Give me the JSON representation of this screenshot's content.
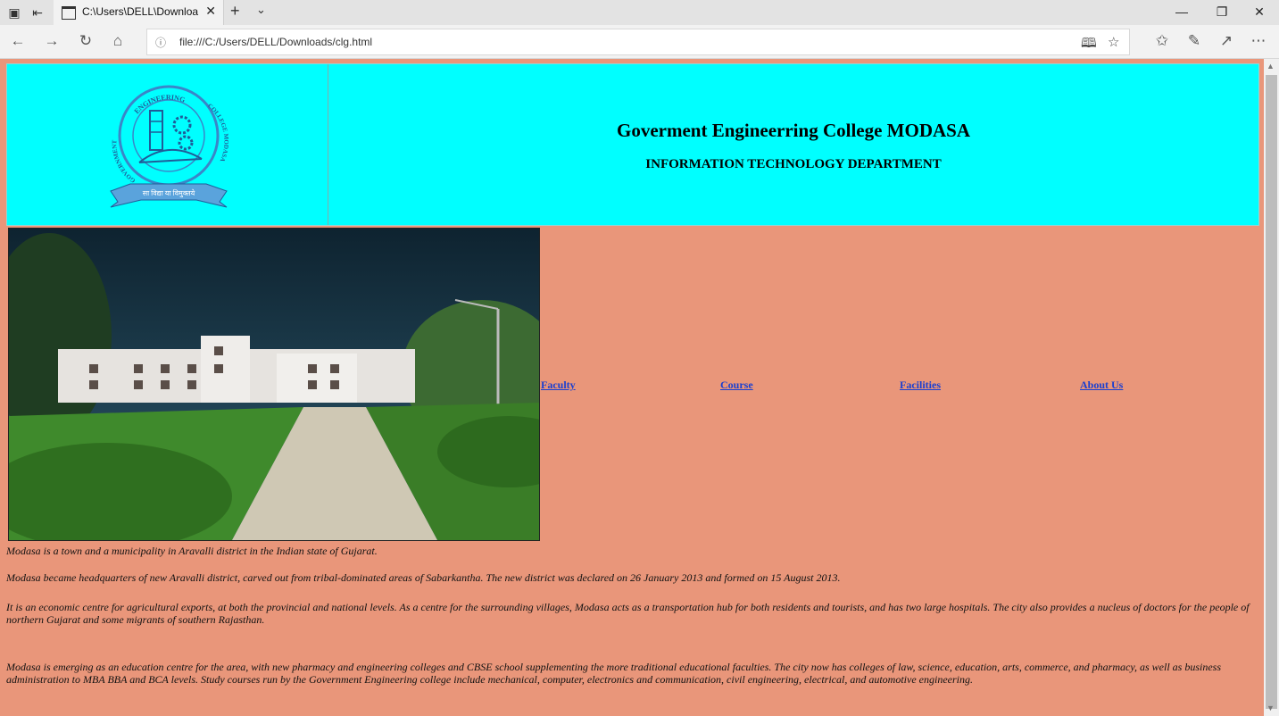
{
  "browser": {
    "tab_title": "C:\\Users\\DELL\\Downloa",
    "address_url": "file:///C:/Users/DELL/Downloads/clg.html"
  },
  "icons": {
    "tab_actions_a": "tab-preview-icon",
    "tab_actions_b": "set-aside-tabs-icon",
    "page": "page-icon",
    "close": "close-icon",
    "new_tab": "plus-icon",
    "tab_dropdown": "chevron-down-icon",
    "back": "back-arrow-icon",
    "forward": "forward-arrow-icon",
    "refresh": "refresh-icon",
    "home": "home-icon",
    "info": "info-icon",
    "reading_view": "reading-view-icon",
    "favorite": "star-icon",
    "favorites_hub": "favorites-list-icon",
    "notes": "pen-icon",
    "share": "share-icon",
    "more": "more-icon",
    "minimize": "minimize-icon",
    "restore": "restore-icon",
    "window_close": "window-close-icon"
  },
  "header": {
    "college_name": "Goverment Engineerring College MODASA",
    "department": "INFORMATION TECHNOLOGY DEPARTMENT",
    "logo_text_top": "ENGINEERING",
    "logo_text_right": "COLLEGE MODASA",
    "logo_text_left": "GOVERNMENT",
    "logo_ribbon": "सा विद्या या विमुक्तये"
  },
  "nav": {
    "faculty": "Faculty",
    "course": "Course",
    "facilities": "Facilities",
    "about": "About Us"
  },
  "content": {
    "p1": "Modasa is a town and a municipality in Aravalli district in the Indian state of Gujarat.",
    "p2": "Modasa became headquarters of new Aravalli district, carved out from tribal-dominated areas of Sabarkantha. The new district was declared on 26 January 2013 and formed on 15 August 2013.",
    "p3": "It is an economic centre for agricultural exports, at both the provincial and national levels. As a centre for the surrounding villages, Modasa acts as a transportation hub for both residents and tourists, and has two large hospitals. The city also provides a nucleus of doctors for the people of northern Gujarat and some migrants of southern Rajasthan.",
    "p4": "Modasa is emerging as an education centre for the area, with new pharmacy and engineering colleges and CBSE school supplementing the more traditional educational faculties. The city now has colleges of law, science, education, arts, commerce, and pharmacy, as well as business administration to MBA BBA and BCA levels. Study courses run by the Government Engineering college include mechanical, computer, electronics and communication, civil engineering, electrical, and automotive engineering."
  },
  "colors": {
    "page_background": "#e9967a",
    "header_background": "#00ffff",
    "link": "#1a3fd0"
  }
}
